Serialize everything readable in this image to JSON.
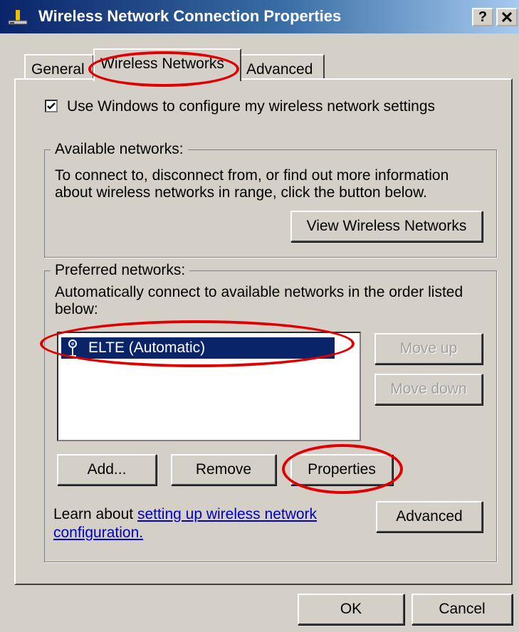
{
  "window": {
    "title": "Wireless Network Connection Properties",
    "help_button": "?",
    "close_button": "✕"
  },
  "tabs": [
    {
      "label": "General",
      "active": false
    },
    {
      "label": "Wireless Networks",
      "active": true
    },
    {
      "label": "Advanced",
      "active": false
    }
  ],
  "panel": {
    "use_windows_checkbox": {
      "label": "Use Windows to configure my wireless network settings",
      "checked": true
    },
    "available_networks": {
      "title": "Available networks:",
      "description": "To connect to, disconnect from, or find out more information about wireless networks in range, click the button below.",
      "view_button": "View Wireless Networks"
    },
    "preferred_networks": {
      "title": "Preferred networks:",
      "description": "Automatically connect to available networks in the order listed below:",
      "list": [
        {
          "label": "ELTE (Automatic)",
          "selected": true,
          "icon": "wireless-network-icon"
        }
      ],
      "move_up_button": "Move up",
      "move_down_button": "Move down",
      "add_button": "Add...",
      "remove_button": "Remove",
      "properties_button": "Properties"
    },
    "learn": {
      "prefix": "Learn about ",
      "link": "setting up wireless network configuration."
    },
    "advanced_button": "Advanced"
  },
  "footer": {
    "ok_button": "OK",
    "cancel_button": "Cancel"
  },
  "colors": {
    "titlebar_start": "#0a246a",
    "titlebar_end": "#a6caf0",
    "face": "#d4d0c8",
    "selection": "#0a246a",
    "link": "#0000c0",
    "annotation": "#e10000"
  }
}
